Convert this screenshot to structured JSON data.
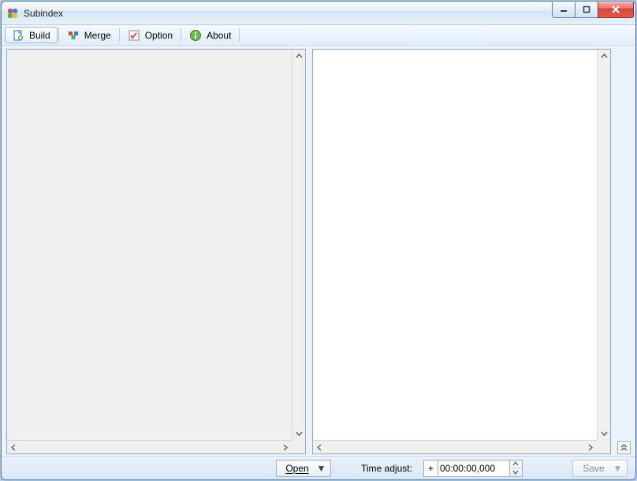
{
  "window": {
    "title": "Subindex"
  },
  "toolbar": {
    "build": "Build",
    "merge": "Merge",
    "option": "Option",
    "about": "About"
  },
  "bottom": {
    "open_label": "Open",
    "time_label": "Time adjust:",
    "time_sign": "+",
    "time_value": "00:00:00,000",
    "save_label": "Save"
  }
}
